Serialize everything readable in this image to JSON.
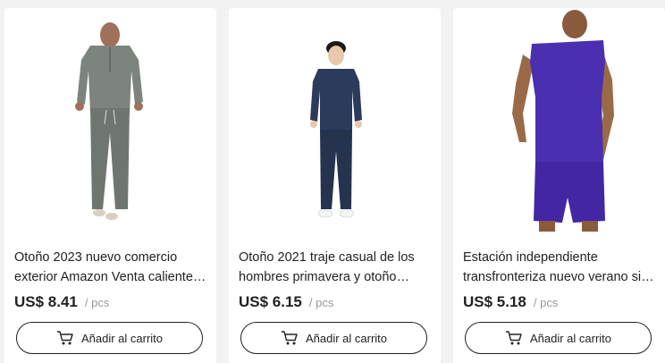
{
  "products": [
    {
      "title": "Otoño 2023 nuevo comercio exterior Amazon Venta caliente hombres conjunto",
      "price": "US$ 8.41",
      "unit": "/ pcs",
      "cart_label": "Añadir al carrito",
      "image": "gray-long-sleeve-pants-set"
    },
    {
      "title": "Otoño 2021 traje casual de los hombres primavera y otoño moda",
      "price": "US$ 6.15",
      "unit": "/ pcs",
      "cart_label": "Añadir al carrito",
      "image": "navy-sweatshirt-pants-set"
    },
    {
      "title": "Estación independiente transfronteriza nuevo verano sin mangas",
      "price": "US$ 5.18",
      "unit": "/ pcs",
      "cart_label": "Añadir al carrito",
      "image": "purple-tank-shorts-set"
    }
  ],
  "colors": {
    "page_bg": "#f2f2f2",
    "card_bg": "#ffffff",
    "text": "#222222",
    "muted": "#999999",
    "gray_set": "#7d837d",
    "navy_set": "#2c3a5c",
    "purple_set": "#4a2fb0",
    "skin": "#b07a55"
  }
}
